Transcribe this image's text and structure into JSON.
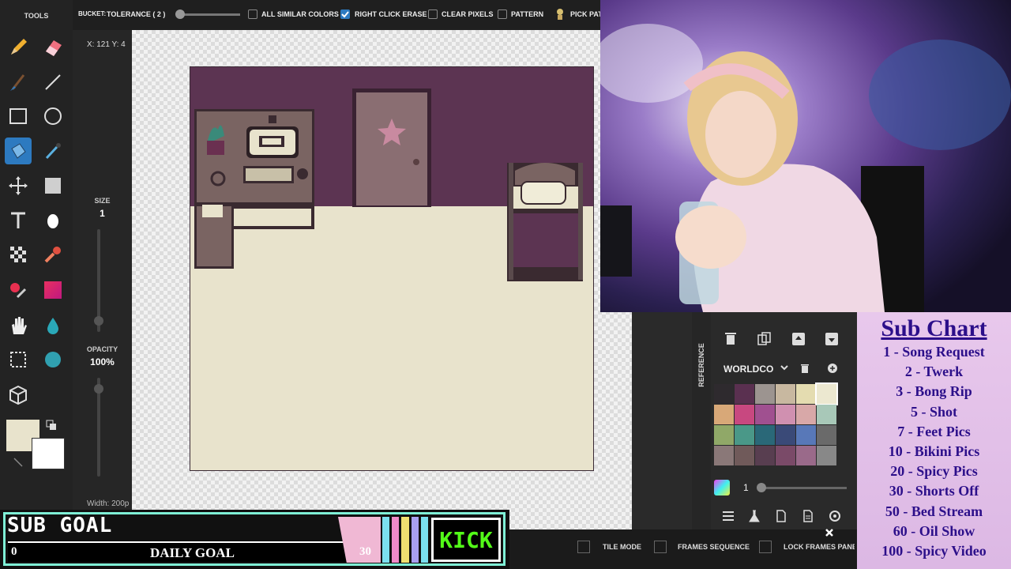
{
  "tools_panel": {
    "title": "TOOLS",
    "tools": [
      "pencil-tool",
      "eraser-tool",
      "brush-tool",
      "line-tool",
      "rectangle-tool",
      "ellipse-tool",
      "bucket-tool",
      "eyedropper-tool",
      "move-tool",
      "select-tool",
      "text-tool",
      "dodge-tool",
      "dither-tool",
      "smudge-tool",
      "color-replace-tool",
      "gradient-tool",
      "hand-tool",
      "blur-tool",
      "crop-tool",
      "shade-tool",
      "3d-tool"
    ],
    "active_tool": "bucket-tool",
    "primary_color": "#e8e3cc",
    "secondary_color": "#ffffff"
  },
  "size_panel": {
    "size_label": "SIZE",
    "size_value": "1",
    "opacity_label": "OPACITY",
    "opacity_value": "100%"
  },
  "toolbar": {
    "bucket_label": "BUCKET:",
    "tolerance_label": "TOLERANCE ( 2 )",
    "options": [
      {
        "label": "ALL SIMILAR COLORS",
        "checked": false
      },
      {
        "label": "RIGHT CLICK ERASE",
        "checked": true
      },
      {
        "label": "CLEAR PIXELS",
        "checked": false
      },
      {
        "label": "PATTERN",
        "checked": false
      }
    ],
    "pick_label": "PICK PAT"
  },
  "status": {
    "coords": "X: 121 Y: 4",
    "width_label": "Width: 200p"
  },
  "palette_panel": {
    "tab_label": "REFERENCE",
    "palette_name": "WORLDCO",
    "layer_opacity": "1",
    "swatches": [
      "#2e2a2e",
      "#5a3050",
      "#9c9490",
      "#c8b8a0",
      "#e4dcb0",
      "#ece8d0",
      "#d8a878",
      "#c84880",
      "#a05090",
      "#d090b0",
      "#d8a8a8",
      "#a8c8b8",
      "#90a868",
      "#4a9888",
      "#2a6878",
      "#3a4a78",
      "#5878b8",
      "#6a6a6a",
      "#8a7878",
      "#705a5a",
      "#583e50",
      "#7a4a68",
      "#9a6a8a",
      "#888888"
    ]
  },
  "bottom_bar": {
    "options": [
      "TILE MODE",
      "FRAMES SEQUENCE",
      "LOCK FRAMES PANEL"
    ]
  },
  "sub_chart": {
    "title": "Sub Chart",
    "items": [
      "1 - Song Request",
      "2 - Twerk",
      "3 - Bong Rip",
      "5 - Shot",
      "7 - Feet Pics",
      "10 - Bikini Pics",
      "20 - Spicy Pics",
      "30 - Shorts Off",
      "50 - Bed Stream",
      "60 - Oil Show",
      "100 - Spicy Video"
    ]
  },
  "sub_goal": {
    "title": "SUB GOAL",
    "current": "0",
    "label": "DAILY GOAL",
    "target": "30",
    "platform": "KICK"
  }
}
